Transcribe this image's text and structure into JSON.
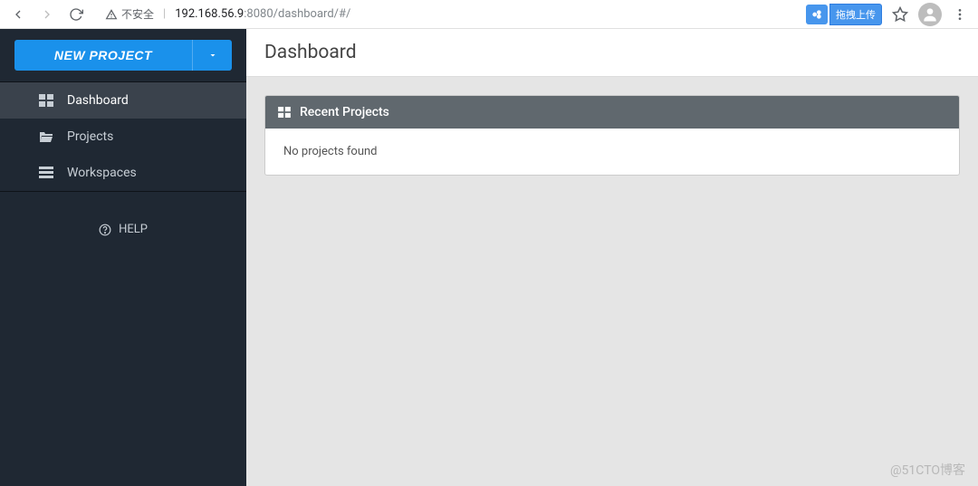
{
  "browser": {
    "security_label": "不安全",
    "url_host": "192.168.56.9",
    "url_port_path": ":8080/dashboard/#/",
    "extension_label": "拖拽上传"
  },
  "sidebar": {
    "new_project_label": "NEW PROJECT",
    "items": [
      {
        "label": "Dashboard"
      },
      {
        "label": "Projects"
      },
      {
        "label": "Workspaces"
      }
    ],
    "help_label": "HELP"
  },
  "main": {
    "title": "Dashboard",
    "panel_title": "Recent Projects",
    "empty_message": "No projects found"
  },
  "watermark": "@51CTO博客"
}
